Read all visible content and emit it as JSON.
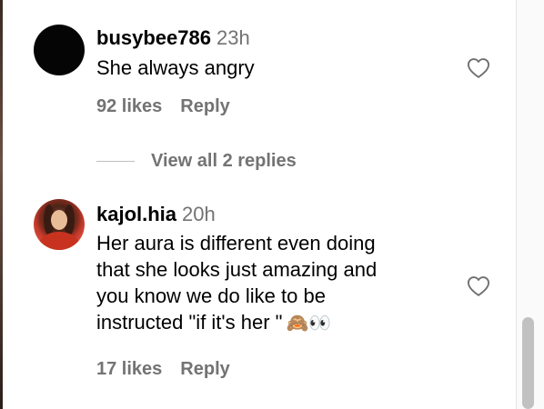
{
  "comments": [
    {
      "username": "busybee786",
      "time": "23h",
      "lines": [
        "She always angry"
      ],
      "likes": "92 likes",
      "reply": "Reply",
      "avatar": "black-circle"
    },
    {
      "username": "kajol.hia",
      "time": "20h",
      "lines": [
        "Her aura is different even doing",
        "that she looks just amazing and",
        "you know we do like to be",
        "instructed \"if it's her \""
      ],
      "emoji": "🙈👀",
      "likes": "17 likes",
      "reply": "Reply",
      "avatar": "photo"
    }
  ],
  "view_replies": "View all 2 replies",
  "icons": {
    "like": "heart-outline-icon"
  },
  "colors": {
    "text": "#000000",
    "secondary": "#737373",
    "divider": "#bfbfbf"
  }
}
